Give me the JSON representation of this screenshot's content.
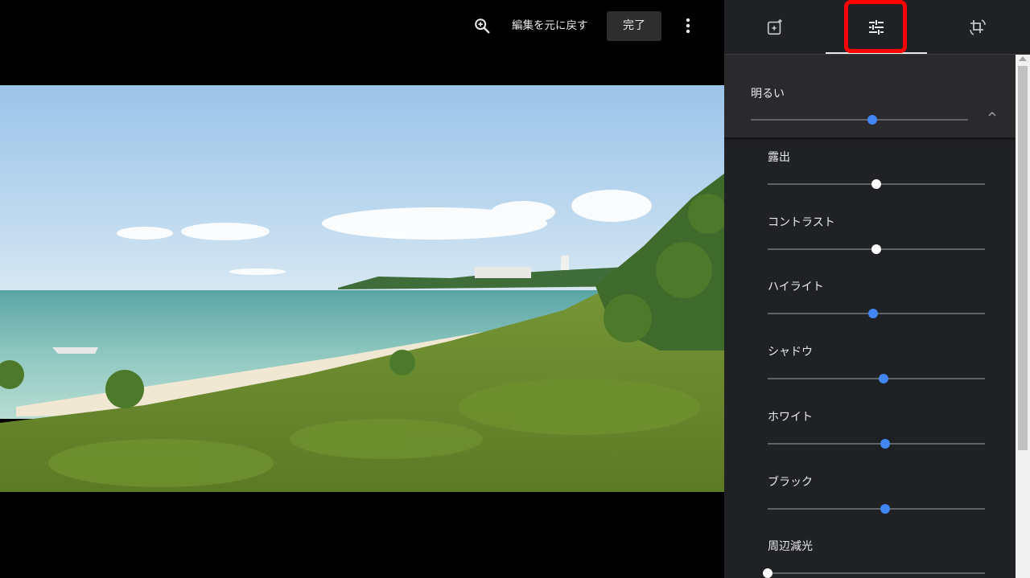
{
  "toolbar": {
    "zoom_icon": "zoom-in-icon",
    "undo_label": "編集を元に戻す",
    "done_label": "完了",
    "more_icon": "more-vert-icon"
  },
  "panel": {
    "tabs": [
      {
        "icon": "auto-enhance-icon"
      },
      {
        "icon": "adjust-sliders-icon",
        "active": true
      },
      {
        "icon": "crop-rotate-icon"
      }
    ],
    "brightness": {
      "label": "明るい",
      "value": 0.56
    },
    "sliders": [
      {
        "label": "露出",
        "value": 0.5,
        "color": "#ffffff"
      },
      {
        "label": "コントラスト",
        "value": 0.5,
        "color": "#ffffff"
      },
      {
        "label": "ハイライト",
        "value": 0.485,
        "color": "#4285f4"
      },
      {
        "label": "シャドウ",
        "value": 0.535,
        "color": "#4285f4"
      },
      {
        "label": "ホワイト",
        "value": 0.54,
        "color": "#4285f4"
      },
      {
        "label": "ブラック",
        "value": 0.54,
        "color": "#4285f4"
      },
      {
        "label": "周辺減光",
        "value": 0.0,
        "color": "#ffffff"
      }
    ]
  },
  "colors": {
    "accent": "#4285f4",
    "highlight_frame": "#ff0000",
    "panel_bg": "#202124"
  }
}
